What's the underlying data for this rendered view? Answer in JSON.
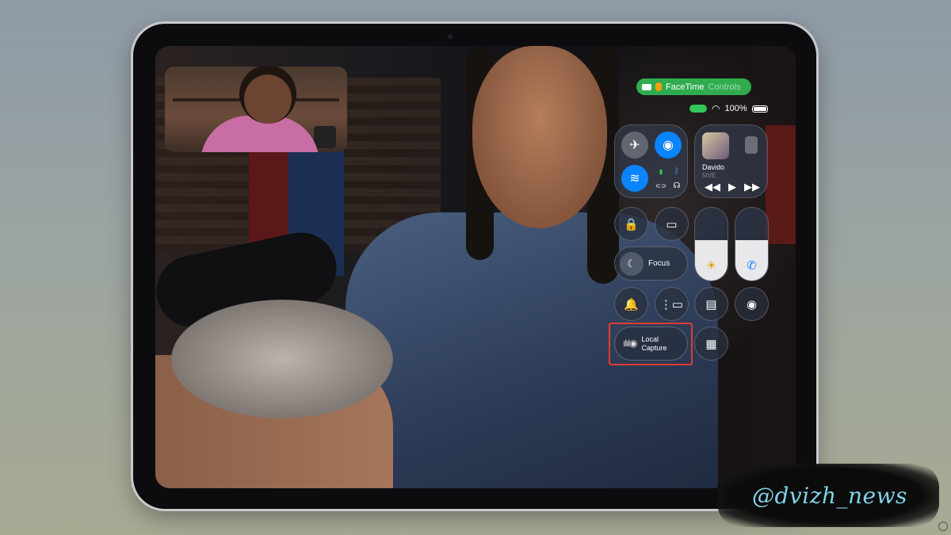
{
  "facetime_pill": {
    "label": "FaceTime",
    "muted": "Controls"
  },
  "status_bar": {
    "battery": "100%"
  },
  "control_center": {
    "connectivity": {
      "airplane": "✈",
      "airdrop": "◉",
      "wifi": "≋",
      "cellular": "▮",
      "bluetooth": "ᛒ",
      "hotspot": "⊂⊃",
      "voice": "☊"
    },
    "now_playing": {
      "artist": "Davido",
      "song": "5IVE",
      "prev": "◀◀",
      "play": "▶",
      "next": "▶▶"
    },
    "orientation_lock": "🔒",
    "screen_mirroring": "▭",
    "focus": {
      "icon": "☾",
      "label": "Focus"
    },
    "brightness": {
      "icon": "☀",
      "level": 0.55
    },
    "call": {
      "icon": "✆",
      "level": 0.55
    },
    "bell": "🔔",
    "stage_manager": "⋮▭",
    "quick_note": "▤",
    "screen_record": "◉",
    "local_capture": {
      "icon": "ılıl◉",
      "label_line1": "Local",
      "label_line2": "Capture"
    },
    "calculator": "▦"
  },
  "watermark": "@dvizh_news",
  "colors": {
    "facetime_green": "#34c759",
    "highlight": "#e23b2f",
    "watermark_text": "#7fd4e6"
  }
}
